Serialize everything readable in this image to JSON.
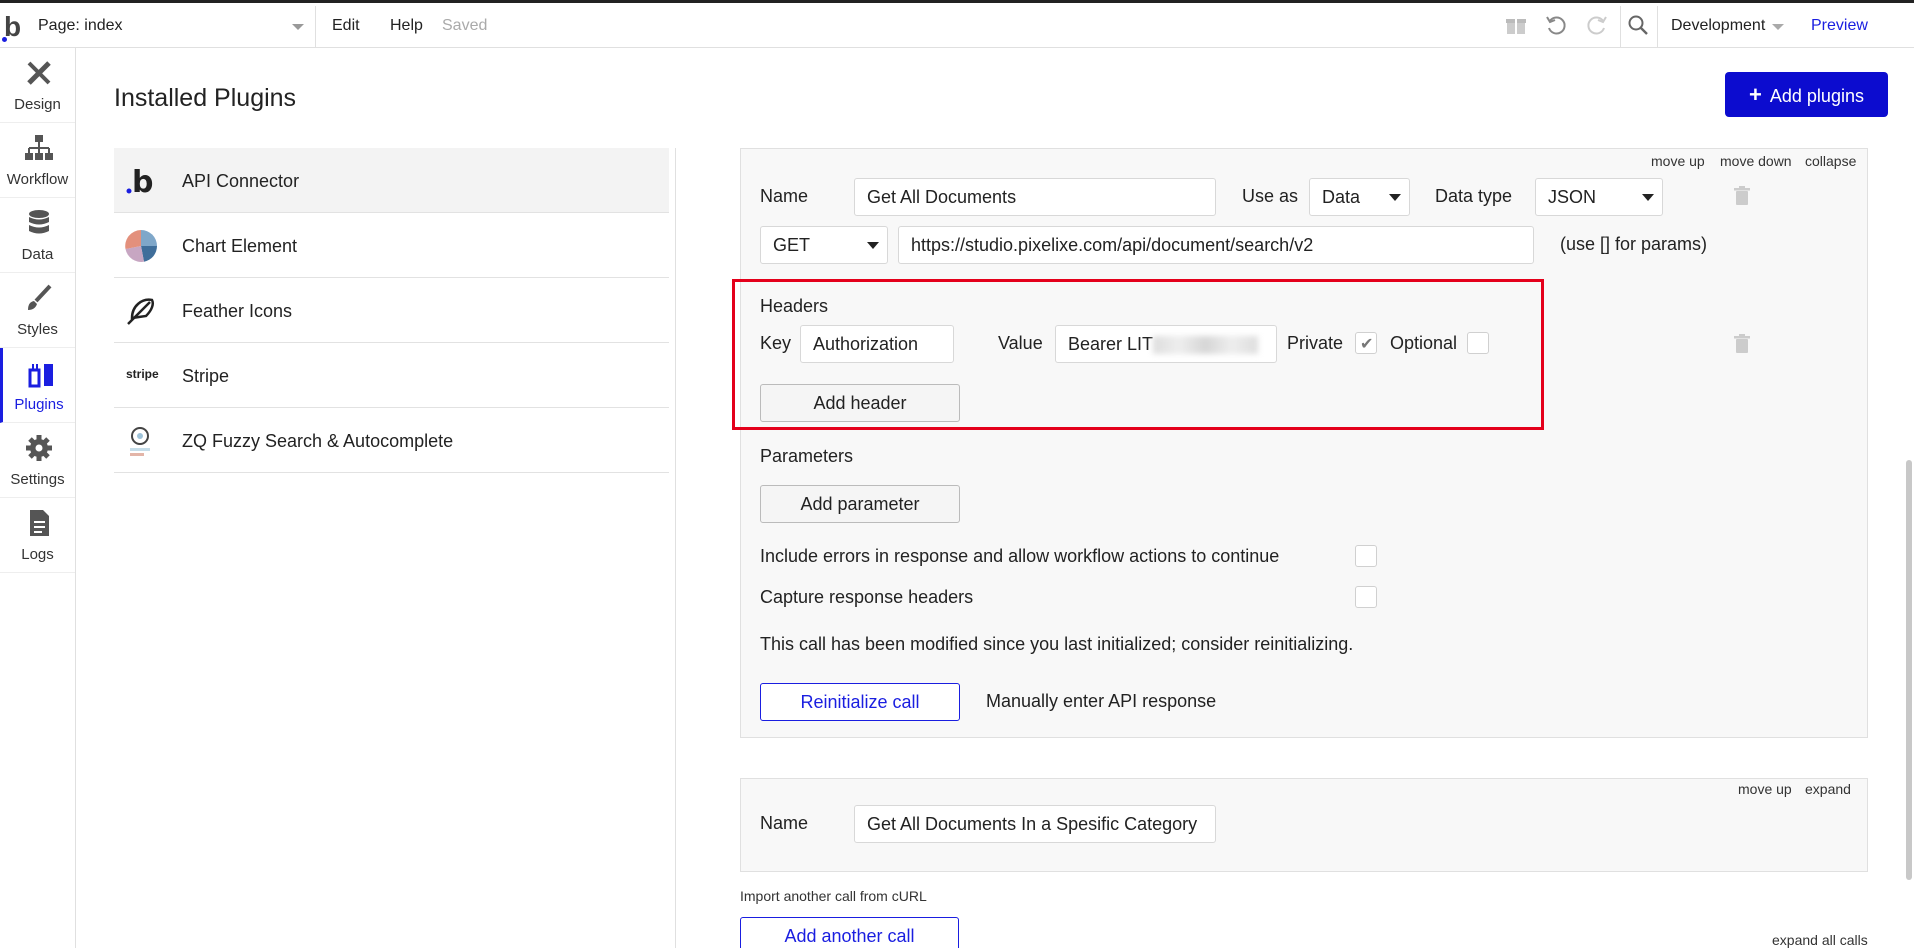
{
  "topbar": {
    "logo": "b",
    "page_select": "Page: index",
    "edit": "Edit",
    "help": "Help",
    "saved": "Saved",
    "environment": "Development",
    "preview": "Preview"
  },
  "sidenav": {
    "items": [
      {
        "label": "Design",
        "icon": "design-icon"
      },
      {
        "label": "Workflow",
        "icon": "workflow-icon"
      },
      {
        "label": "Data",
        "icon": "database-icon"
      },
      {
        "label": "Styles",
        "icon": "brush-icon"
      },
      {
        "label": "Plugins",
        "icon": "plugins-icon",
        "active": true
      },
      {
        "label": "Settings",
        "icon": "gear-icon"
      },
      {
        "label": "Logs",
        "icon": "document-icon"
      }
    ]
  },
  "header": {
    "title": "Installed Plugins",
    "add_plugins": "Add plugins"
  },
  "plugins": {
    "items": [
      {
        "label": "API Connector",
        "icon": "bubble-logo-icon",
        "selected": true
      },
      {
        "label": "Chart Element",
        "icon": "pie-chart-icon"
      },
      {
        "label": "Feather Icons",
        "icon": "feather-icon"
      },
      {
        "label": "Stripe",
        "icon": "stripe-logo-icon",
        "icon_text": "stripe"
      },
      {
        "label": "ZQ Fuzzy Search & Autocomplete",
        "icon": "fuzzy-search-icon"
      }
    ]
  },
  "call": {
    "move_up": "move up",
    "move_down": "move down",
    "collapse": "collapse",
    "name_label": "Name",
    "name_value": "Get All Documents",
    "use_as_label": "Use as",
    "use_as_value": "Data",
    "data_type_label": "Data type",
    "data_type_value": "JSON",
    "method": "GET",
    "url": "https://studio.pixelixe.com/api/document/search/v2",
    "params_hint": "(use [] for params)",
    "headers_label": "Headers",
    "key_label": "Key",
    "key_value": "Authorization",
    "value_label": "Value",
    "value_value": "Bearer LIT",
    "private_label": "Private",
    "private_checked": true,
    "optional_label": "Optional",
    "optional_checked": false,
    "add_header": "Add header",
    "parameters_label": "Parameters",
    "add_parameter": "Add parameter",
    "include_errors": "Include errors in response and allow workflow actions to continue",
    "capture_headers": "Capture response headers",
    "modified_notice": "This call has been modified since you last initialized; consider reinitializing.",
    "reinitialize": "Reinitialize call",
    "manual_response": "Manually enter API response"
  },
  "call2": {
    "move_up": "move up",
    "expand": "expand",
    "name_label": "Name",
    "name_value": "Get All Documents In a Spesific Category"
  },
  "footer": {
    "import_curl": "Import another call from cURL",
    "add_another_call": "Add another call",
    "expand_all": "expand all calls"
  },
  "colors": {
    "brand_blue": "#0c0ccf",
    "highlight_red": "#e4001b"
  }
}
